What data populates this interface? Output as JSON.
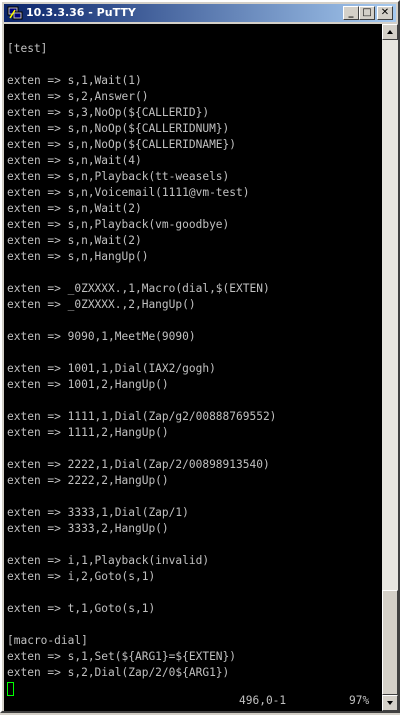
{
  "window": {
    "title": "10.3.3.36 - PuTTY",
    "app_icon": "putty-icon",
    "controls": {
      "minimize": "_",
      "maximize": "□",
      "close": "✕"
    }
  },
  "terminal": {
    "colors": {
      "background": "#000000",
      "foreground": "#c0c0c0",
      "cursor": "#00ff00"
    },
    "lines": [
      "[test]",
      "",
      "exten => s,1,Wait(1)",
      "exten => s,2,Answer()",
      "exten => s,3,NoOp(${CALLERID})",
      "exten => s,n,NoOp(${CALLERIDNUM})",
      "exten => s,n,NoOp(${CALLERIDNAME})",
      "exten => s,n,Wait(4)",
      "exten => s,n,Playback(tt-weasels)",
      "exten => s,n,Voicemail(1111@vm-test)",
      "exten => s,n,Wait(2)",
      "exten => s,n,Playback(vm-goodbye)",
      "exten => s,n,Wait(2)",
      "exten => s,n,HangUp()",
      "",
      "exten => _0ZXXXX.,1,Macro(dial,$(EXTEN)",
      "exten => _0ZXXXX.,2,HangUp()",
      "",
      "exten => 9090,1,MeetMe(9090)",
      "",
      "exten => 1001,1,Dial(IAX2/gogh)",
      "exten => 1001,2,HangUp()",
      "",
      "exten => 1111,1,Dial(Zap/g2/00888769552)",
      "exten => 1111,2,HangUp()",
      "",
      "exten => 2222,1,Dial(Zap/2/00898913540)",
      "exten => 2222,2,HangUp()",
      "",
      "exten => 3333,1,Dial(Zap/1)",
      "exten => 3333,2,HangUp()",
      "",
      "exten => i,1,Playback(invalid)",
      "exten => i,2,Goto(s,1)",
      "",
      "exten => t,1,Goto(s,1)",
      "",
      "[macro-dial]",
      "exten => s,1,Set(${ARG1}=${EXTEN})",
      "exten => s,2,Dial(Zap/2/0${ARG1})"
    ],
    "status": {
      "position": "496,0-1",
      "percent": "97%"
    }
  },
  "scrollbar": {
    "up_icon": "scroll-up-arrow-icon",
    "down_icon": "scroll-down-arrow-icon",
    "position_fraction": 0.97
  }
}
